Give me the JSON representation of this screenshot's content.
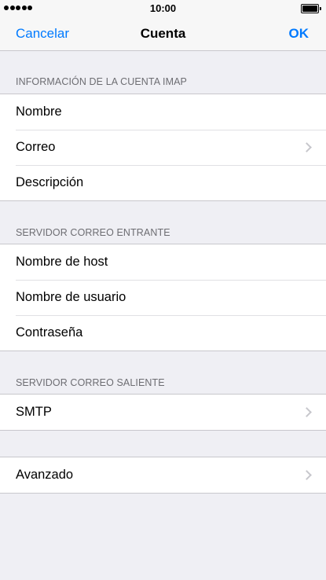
{
  "status_bar": {
    "time": "10:00"
  },
  "nav": {
    "cancel_label": "Cancelar",
    "title": "Cuenta",
    "ok_label": "OK"
  },
  "account_section": {
    "header": "INFORMACIÓN DE LA CUENTA IMAP",
    "rows": [
      {
        "label": "Nombre"
      },
      {
        "label": "Correo"
      },
      {
        "label": "Descripción"
      }
    ]
  },
  "incoming_section": {
    "header": "SERVIDOR CORREO ENTRANTE",
    "rows": [
      {
        "label": "Nombre de host"
      },
      {
        "label": "Nombre de usuario"
      },
      {
        "label": "Contraseña"
      }
    ]
  },
  "outgoing_section": {
    "header": "SERVIDOR CORREO SALIENTE",
    "rows": [
      {
        "label": "SMTP"
      }
    ]
  },
  "advanced_section": {
    "rows": [
      {
        "label": "Avanzado"
      }
    ]
  }
}
